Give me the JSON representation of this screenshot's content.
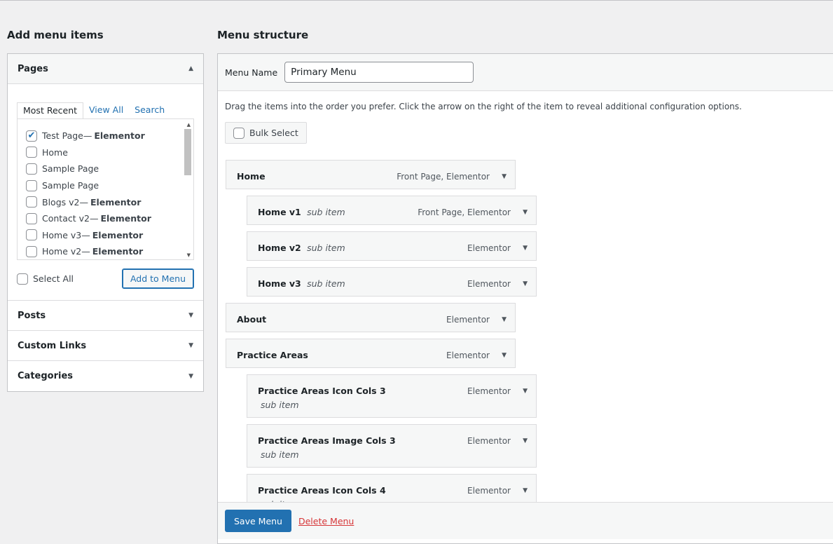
{
  "left": {
    "title": "Add menu items",
    "sections": {
      "pages": "Pages",
      "posts": "Posts",
      "custom_links": "Custom Links",
      "categories": "Categories"
    },
    "tabs": [
      "Most Recent",
      "View All",
      "Search"
    ],
    "pages": [
      {
        "name": "Test Page",
        "suffix": "Elementor",
        "checked": true
      },
      {
        "name": "Home",
        "suffix": "",
        "checked": false
      },
      {
        "name": "Sample Page",
        "suffix": "",
        "checked": false
      },
      {
        "name": "Sample Page",
        "suffix": "",
        "checked": false
      },
      {
        "name": "Blogs v2",
        "suffix": "Elementor",
        "checked": false
      },
      {
        "name": "Contact v2",
        "suffix": "Elementor",
        "checked": false
      },
      {
        "name": "Home v3",
        "suffix": "Elementor",
        "checked": false
      },
      {
        "name": "Home v2",
        "suffix": "Elementor",
        "checked": false
      }
    ],
    "select_all": "Select All",
    "add_to_menu": "Add to Menu"
  },
  "right": {
    "title": "Menu structure",
    "menu_name_label": "Menu Name",
    "menu_name_value": "Primary Menu",
    "instructions": "Drag the items into the order you prefer. Click the arrow on the right of the item to reveal additional configuration options.",
    "bulk_select": "Bulk Select",
    "items": [
      {
        "title": "Home",
        "sub": "",
        "meta": "Front Page, Elementor"
      },
      {
        "title": "Home v1",
        "sub": "sub item",
        "meta": "Front Page, Elementor"
      },
      {
        "title": "Home v2",
        "sub": "sub item",
        "meta": "Elementor"
      },
      {
        "title": "Home v3",
        "sub": "sub item",
        "meta": "Elementor"
      },
      {
        "title": "About",
        "sub": "",
        "meta": "Elementor"
      },
      {
        "title": "Practice Areas",
        "sub": "",
        "meta": "Elementor"
      },
      {
        "title": "Practice Areas Icon Cols 3",
        "sub": "sub item",
        "meta": "Elementor"
      },
      {
        "title": "Practice Areas Image Cols 3",
        "sub": "sub item",
        "meta": "Elementor"
      },
      {
        "title": "Practice Areas Icon Cols 4",
        "sub": "sub item",
        "meta": "Elementor"
      }
    ],
    "save": "Save Menu",
    "delete": "Delete Menu"
  }
}
